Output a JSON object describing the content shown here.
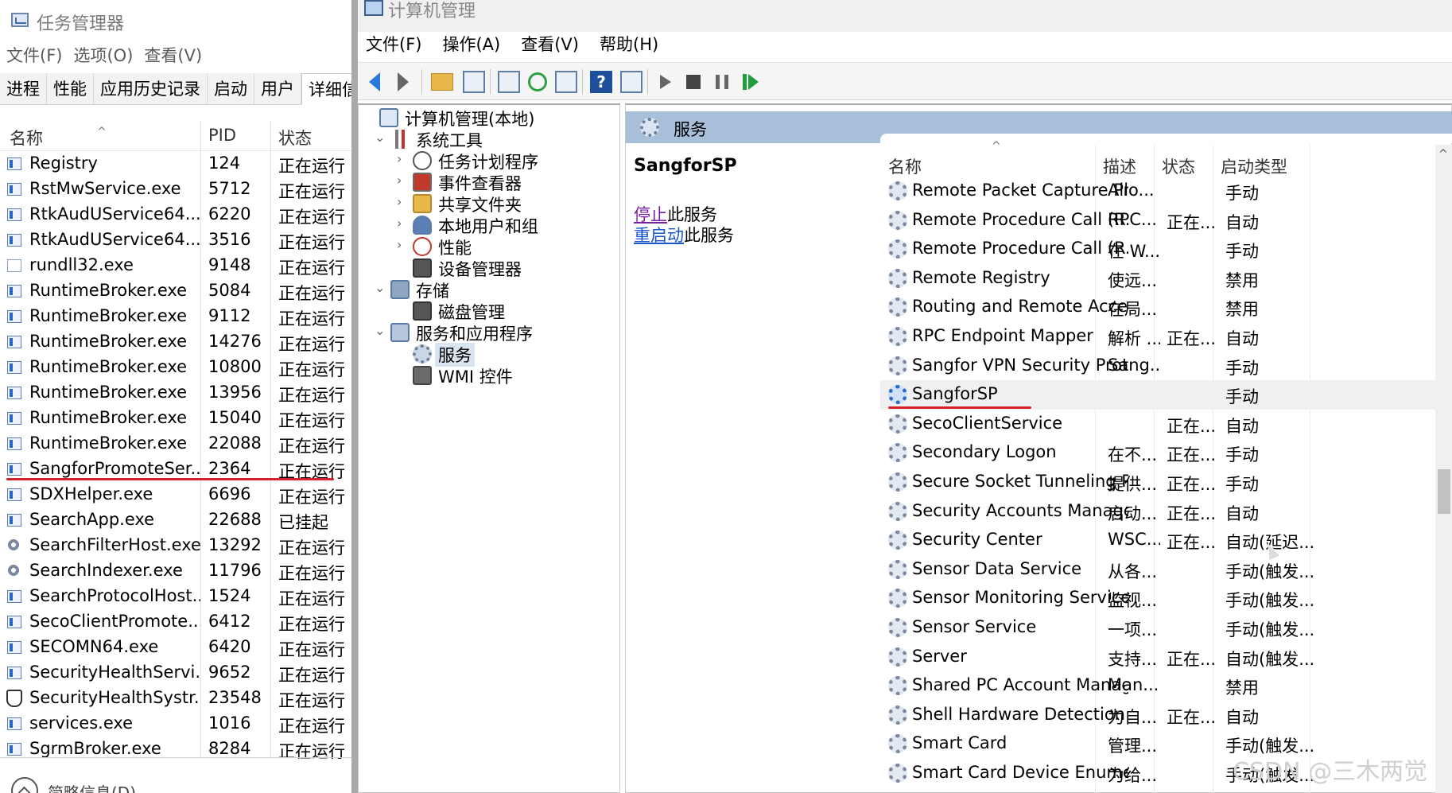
{
  "task_manager": {
    "title": "任务管理器",
    "menu": [
      "文件(F)",
      "选项(O)",
      "查看(V)"
    ],
    "tabs": [
      "进程",
      "性能",
      "应用历史记录",
      "启动",
      "用户",
      "详细信息"
    ],
    "active_tab": "详细信息",
    "columns": {
      "name": "名称",
      "pid": "PID",
      "status": "状态"
    },
    "rows": [
      {
        "name": "Registry",
        "pid": "124",
        "status": "正在运行",
        "icon": "exe-icon"
      },
      {
        "name": "RstMwService.exe",
        "pid": "5712",
        "status": "正在运行",
        "icon": "exe-icon"
      },
      {
        "name": "RtkAudUService64....",
        "pid": "6220",
        "status": "正在运行",
        "icon": "exe-icon"
      },
      {
        "name": "RtkAudUService64....",
        "pid": "3516",
        "status": "正在运行",
        "icon": "exe-icon"
      },
      {
        "name": "rundll32.exe",
        "pid": "9148",
        "status": "正在运行",
        "icon": "document-icon"
      },
      {
        "name": "RuntimeBroker.exe",
        "pid": "5084",
        "status": "正在运行",
        "icon": "exe-icon"
      },
      {
        "name": "RuntimeBroker.exe",
        "pid": "9112",
        "status": "正在运行",
        "icon": "exe-icon"
      },
      {
        "name": "RuntimeBroker.exe",
        "pid": "14276",
        "status": "正在运行",
        "icon": "exe-icon"
      },
      {
        "name": "RuntimeBroker.exe",
        "pid": "10800",
        "status": "正在运行",
        "icon": "exe-icon"
      },
      {
        "name": "RuntimeBroker.exe",
        "pid": "13956",
        "status": "正在运行",
        "icon": "exe-icon"
      },
      {
        "name": "RuntimeBroker.exe",
        "pid": "15040",
        "status": "正在运行",
        "icon": "exe-icon"
      },
      {
        "name": "RuntimeBroker.exe",
        "pid": "22088",
        "status": "正在运行",
        "icon": "exe-icon"
      },
      {
        "name": "SangforPromoteSer...",
        "pid": "2364",
        "status": "正在运行",
        "icon": "exe-icon"
      },
      {
        "name": "SDXHelper.exe",
        "pid": "6696",
        "status": "正在运行",
        "icon": "exe-icon"
      },
      {
        "name": "SearchApp.exe",
        "pid": "22688",
        "status": "已挂起",
        "icon": "exe-icon"
      },
      {
        "name": "SearchFilterHost.exe",
        "pid": "13292",
        "status": "正在运行",
        "icon": "search-gear-icon"
      },
      {
        "name": "SearchIndexer.exe",
        "pid": "11796",
        "status": "正在运行",
        "icon": "search-gear-icon"
      },
      {
        "name": "SearchProtocolHost...",
        "pid": "1524",
        "status": "正在运行",
        "icon": "exe-icon"
      },
      {
        "name": "SecoClientPromote...",
        "pid": "6412",
        "status": "正在运行",
        "icon": "exe-icon"
      },
      {
        "name": "SECOMN64.exe",
        "pid": "6420",
        "status": "正在运行",
        "icon": "exe-icon"
      },
      {
        "name": "SecurityHealthServi...",
        "pid": "9652",
        "status": "正在运行",
        "icon": "exe-icon"
      },
      {
        "name": "SecurityHealthSystr...",
        "pid": "23548",
        "status": "正在运行",
        "icon": "shield-icon"
      },
      {
        "name": "services.exe",
        "pid": "1016",
        "status": "正在运行",
        "icon": "exe-icon"
      },
      {
        "name": "SgrmBroker.exe",
        "pid": "8284",
        "status": "正在运行",
        "icon": "exe-icon"
      }
    ],
    "footer_label": "简略信息(D)"
  },
  "computer_management": {
    "title": "计算机管理",
    "menu": [
      "文件(F)",
      "操作(A)",
      "查看(V)",
      "帮助(H)"
    ],
    "toolbar_icons": [
      "back-arrow-icon",
      "forward-arrow-icon",
      "up-folder-icon",
      "show-hide-tree-icon",
      "properties-icon",
      "refresh-icon",
      "export-list-icon",
      "help-icon",
      "view-pane-icon",
      "start-service-icon",
      "stop-service-icon",
      "pause-service-icon",
      "restart-service-icon"
    ],
    "tree": [
      {
        "label": "计算机管理(本地)",
        "level": 0,
        "expander": "",
        "icon": "computer-icon"
      },
      {
        "label": "系统工具",
        "level": 1,
        "expander": "⌄",
        "icon": "tools-icon"
      },
      {
        "label": "任务计划程序",
        "level": 2,
        "expander": "›",
        "icon": "clock-icon"
      },
      {
        "label": "事件查看器",
        "level": 2,
        "expander": "›",
        "icon": "event-viewer-icon"
      },
      {
        "label": "共享文件夹",
        "level": 2,
        "expander": "›",
        "icon": "shared-folder-icon"
      },
      {
        "label": "本地用户和组",
        "level": 2,
        "expander": "›",
        "icon": "users-icon"
      },
      {
        "label": "性能",
        "level": 2,
        "expander": "›",
        "icon": "performance-icon"
      },
      {
        "label": "设备管理器",
        "level": 2,
        "expander": "",
        "icon": "device-manager-icon"
      },
      {
        "label": "存储",
        "level": 1,
        "expander": "⌄",
        "icon": "storage-icon"
      },
      {
        "label": "磁盘管理",
        "level": 2,
        "expander": "",
        "icon": "disk-icon"
      },
      {
        "label": "服务和应用程序",
        "level": 1,
        "expander": "⌄",
        "icon": "services-apps-icon"
      },
      {
        "label": "服务",
        "level": 2,
        "expander": "",
        "icon": "gear-icon",
        "selected": true
      },
      {
        "label": "WMI 控件",
        "level": 2,
        "expander": "",
        "icon": "wmi-icon"
      }
    ],
    "services_header": "服务",
    "selected_service": "SangforSP",
    "actions": [
      {
        "link": "停止",
        "rest": "此服务"
      },
      {
        "link": "重启动",
        "rest": "此服务"
      }
    ],
    "columns": {
      "name": "名称",
      "description": "描述",
      "status": "状态",
      "startup": "启动类型"
    },
    "services": [
      {
        "name": "Remote Packet Capture Pr...",
        "description": "Allo...",
        "status": "",
        "startup": "手动"
      },
      {
        "name": "Remote Procedure Call (R...",
        "description": "RPC...",
        "status": "正在...",
        "startup": "自动"
      },
      {
        "name": "Remote Procedure Call (R...",
        "description": "在 W...",
        "status": "",
        "startup": "手动"
      },
      {
        "name": "Remote Registry",
        "description": "使远...",
        "status": "",
        "startup": "禁用"
      },
      {
        "name": "Routing and Remote Access",
        "description": "在局...",
        "status": "",
        "startup": "禁用"
      },
      {
        "name": "RPC Endpoint Mapper",
        "description": "解析 ...",
        "status": "正在...",
        "startup": "自动"
      },
      {
        "name": "Sangfor VPN Security Prot...",
        "description": "Sang...",
        "status": "",
        "startup": "手动"
      },
      {
        "name": "SangforSP",
        "description": "",
        "status": "",
        "startup": "手动",
        "selected": true
      },
      {
        "name": "SecoClientService",
        "description": "",
        "status": "正在...",
        "startup": "自动"
      },
      {
        "name": "Secondary Logon",
        "description": "在不...",
        "status": "正在...",
        "startup": "手动"
      },
      {
        "name": "Secure Socket Tunneling P...",
        "description": "提供...",
        "status": "正在...",
        "startup": "手动"
      },
      {
        "name": "Security Accounts Manager",
        "description": "启动...",
        "status": "正在...",
        "startup": "自动"
      },
      {
        "name": "Security Center",
        "description": "WSC...",
        "status": "正在...",
        "startup": "自动(延迟..."
      },
      {
        "name": "Sensor Data Service",
        "description": "从各...",
        "status": "",
        "startup": "手动(触发..."
      },
      {
        "name": "Sensor Monitoring Service",
        "description": "监视...",
        "status": "",
        "startup": "手动(触发..."
      },
      {
        "name": "Sensor Service",
        "description": "一项...",
        "status": "",
        "startup": "手动(触发..."
      },
      {
        "name": "Server",
        "description": "支持...",
        "status": "正在...",
        "startup": "自动(触发..."
      },
      {
        "name": "Shared PC Account Manager",
        "description": "Man...",
        "status": "",
        "startup": "禁用"
      },
      {
        "name": "Shell Hardware Detection",
        "description": "为自...",
        "status": "正在...",
        "startup": "自动"
      },
      {
        "name": "Smart Card",
        "description": "管理...",
        "status": "",
        "startup": "手动(触发..."
      },
      {
        "name": "Smart Card Device Enumer...",
        "description": "为给...",
        "status": "",
        "startup": "手动(触发..."
      }
    ]
  },
  "watermark": "CSDN @三木两觉",
  "colors": {
    "highlight_underline": "#d8202a",
    "link": "#1a56c7",
    "visited_link": "#7a1fa2",
    "header_band": "#a7bfd9"
  }
}
